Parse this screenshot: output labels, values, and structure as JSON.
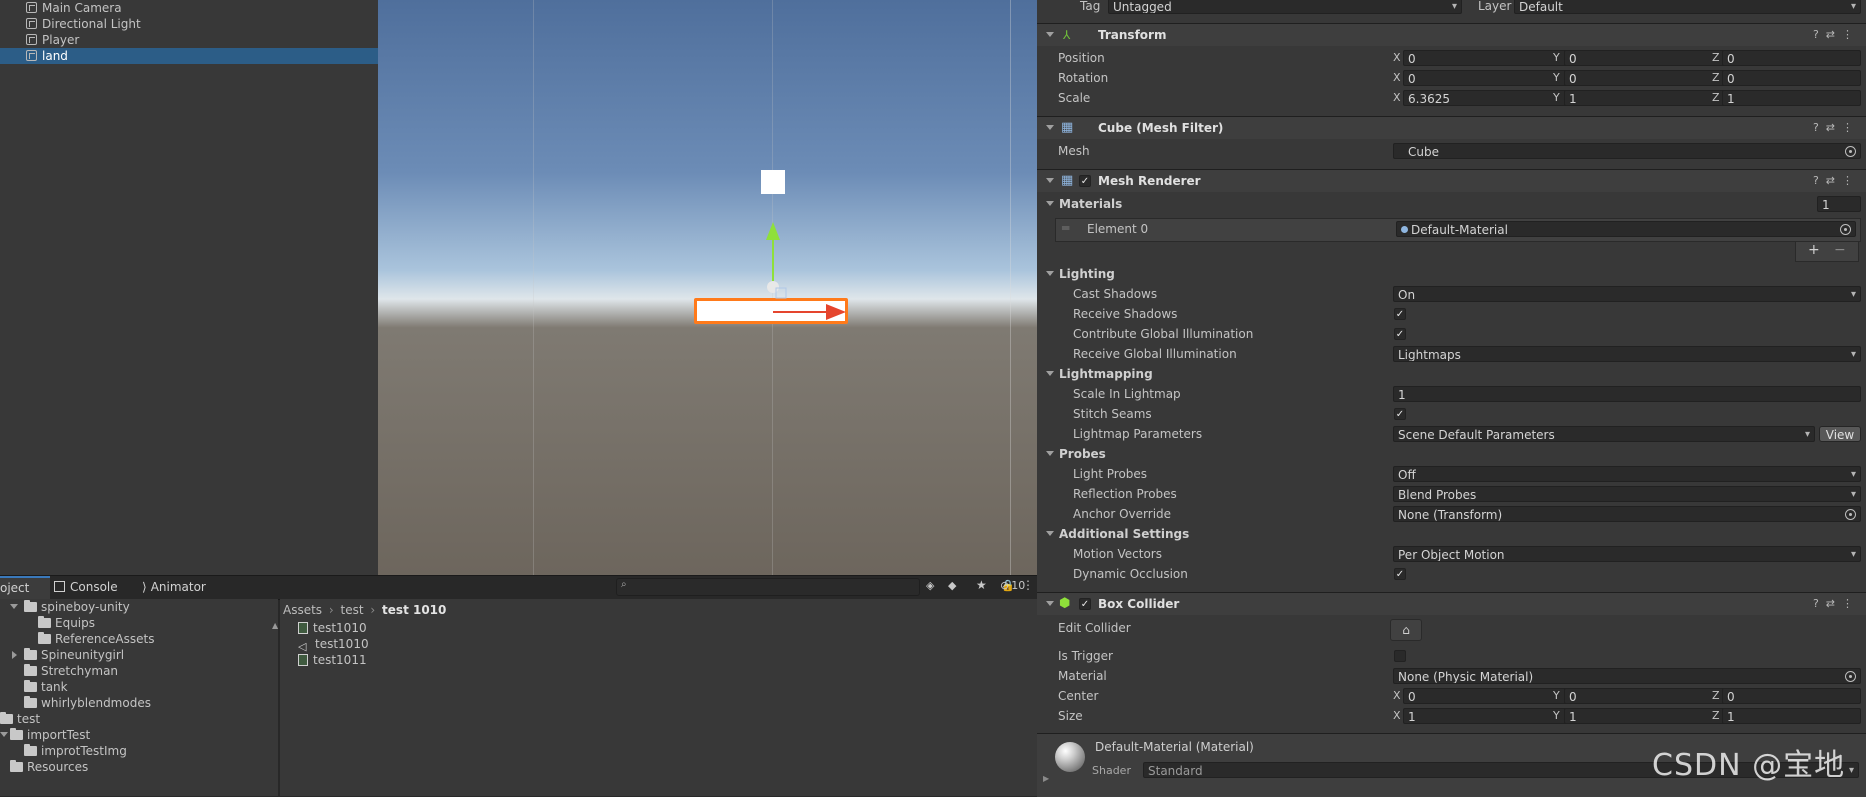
{
  "hierarchy": {
    "items": [
      {
        "label": "Main Camera",
        "selected": false
      },
      {
        "label": "Directional Light",
        "selected": false
      },
      {
        "label": "Player",
        "selected": false
      },
      {
        "label": "land",
        "selected": true
      }
    ]
  },
  "bottom_tabs": {
    "project": "oject",
    "console": "Console",
    "animator": "Animator"
  },
  "project_tree": [
    {
      "label": "spineboy-unity",
      "expanded": true
    },
    {
      "label": "Equips"
    },
    {
      "label": "ReferenceAssets"
    },
    {
      "label": "Spineunitygirl",
      "expanded": false
    },
    {
      "label": "Stretchyman"
    },
    {
      "label": "tank"
    },
    {
      "label": "whirlyblendmodes"
    },
    {
      "label": "test"
    },
    {
      "label": "importTest",
      "expanded": true
    },
    {
      "label": "improtTestImg"
    },
    {
      "label": "Resources"
    }
  ],
  "breadcrumb": {
    "root": "Assets",
    "mid": "test",
    "current": "test 1010"
  },
  "files": [
    "test1010",
    "test1010",
    "test1011"
  ],
  "project_toolbar": {
    "hidden_count": "10"
  },
  "inspector": {
    "tag_label": "Tag",
    "tag_value": "Untagged",
    "layer_label": "Layer",
    "layer_value": "Default",
    "transform": {
      "title": "Transform",
      "position_label": "Position",
      "rotation_label": "Rotation",
      "scale_label": "Scale",
      "position": {
        "x": "0",
        "y": "0",
        "z": "0"
      },
      "rotation": {
        "x": "0",
        "y": "0",
        "z": "0"
      },
      "scale": {
        "x": "6.3625",
        "y": "1",
        "z": "1"
      }
    },
    "mesh_filter": {
      "title": "Cube (Mesh Filter)",
      "mesh_label": "Mesh",
      "mesh_value": "Cube"
    },
    "mesh_renderer": {
      "title": "Mesh Renderer",
      "materials_label": "Materials",
      "materials_count": "1",
      "element_label": "Element 0",
      "element_value": "Default-Material",
      "lighting_label": "Lighting",
      "cast_shadows_label": "Cast Shadows",
      "cast_shadows_value": "On",
      "receive_shadows_label": "Receive Shadows",
      "contribute_gi_label": "Contribute Global Illumination",
      "receive_gi_label": "Receive Global Illumination",
      "receive_gi_value": "Lightmaps",
      "lightmapping_label": "Lightmapping",
      "scale_in_lightmap_label": "Scale In Lightmap",
      "scale_in_lightmap_value": "1",
      "stitch_seams_label": "Stitch Seams",
      "lightmap_params_label": "Lightmap Parameters",
      "lightmap_params_value": "Scene Default Parameters",
      "view_button": "View",
      "probes_label": "Probes",
      "light_probes_label": "Light Probes",
      "light_probes_value": "Off",
      "reflection_probes_label": "Reflection Probes",
      "reflection_probes_value": "Blend Probes",
      "anchor_override_label": "Anchor Override",
      "anchor_override_value": "None (Transform)",
      "additional_label": "Additional Settings",
      "motion_vectors_label": "Motion Vectors",
      "motion_vectors_value": "Per Object Motion",
      "dynamic_occlusion_label": "Dynamic Occlusion"
    },
    "box_collider": {
      "title": "Box Collider",
      "edit_collider_label": "Edit Collider",
      "is_trigger_label": "Is Trigger",
      "material_label": "Material",
      "material_value": "None (Physic Material)",
      "center_label": "Center",
      "size_label": "Size",
      "center": {
        "x": "0",
        "y": "0",
        "z": "0"
      },
      "size": {
        "x": "1",
        "y": "1",
        "z": "1"
      }
    },
    "material_preview": {
      "name": "Default-Material (Material)",
      "shader_label": "Shader",
      "shader_value": "Standard"
    }
  },
  "watermark": "CSDN @宝地",
  "colors": {
    "selection": "#2c5d87",
    "accent_orange": "#ff7a1a",
    "gizmo_green": "#8fe03a",
    "gizmo_red": "#e5452e"
  }
}
